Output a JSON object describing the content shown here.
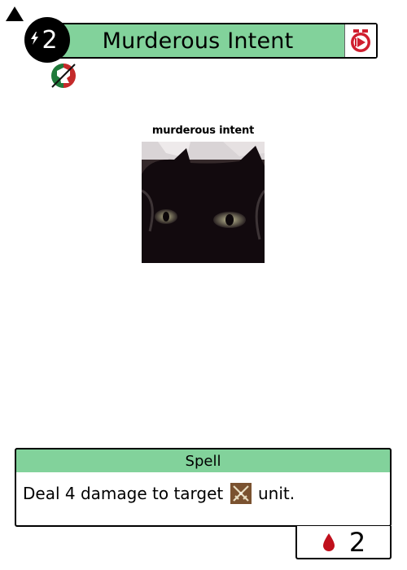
{
  "card": {
    "name": "Murderous Intent",
    "cost": "2",
    "type": "Spell",
    "rules_text_before": "Deal 4 damage to target",
    "rules_text_after": "unit.",
    "art_caption": "murderous intent",
    "stat_value": "2"
  },
  "icons": {
    "corner": "triangle-marker-icon",
    "cost": "lightning-bolt-icon",
    "speed": "fast-spell-icon",
    "faction": "faction-emblem-icon",
    "keyword": "crossed-swords-icon",
    "stat": "blood-drop-icon"
  },
  "colors": {
    "title_bar": "#82d29b",
    "type_bar": "#82d29b",
    "cost_circle": "#000000",
    "speed_icon": "#d01f2f",
    "emblem_green": "#1f7a3a",
    "emblem_red": "#c42a2a",
    "keyword_icon_bg": "#7a5230",
    "blood_drop": "#c0101c"
  }
}
